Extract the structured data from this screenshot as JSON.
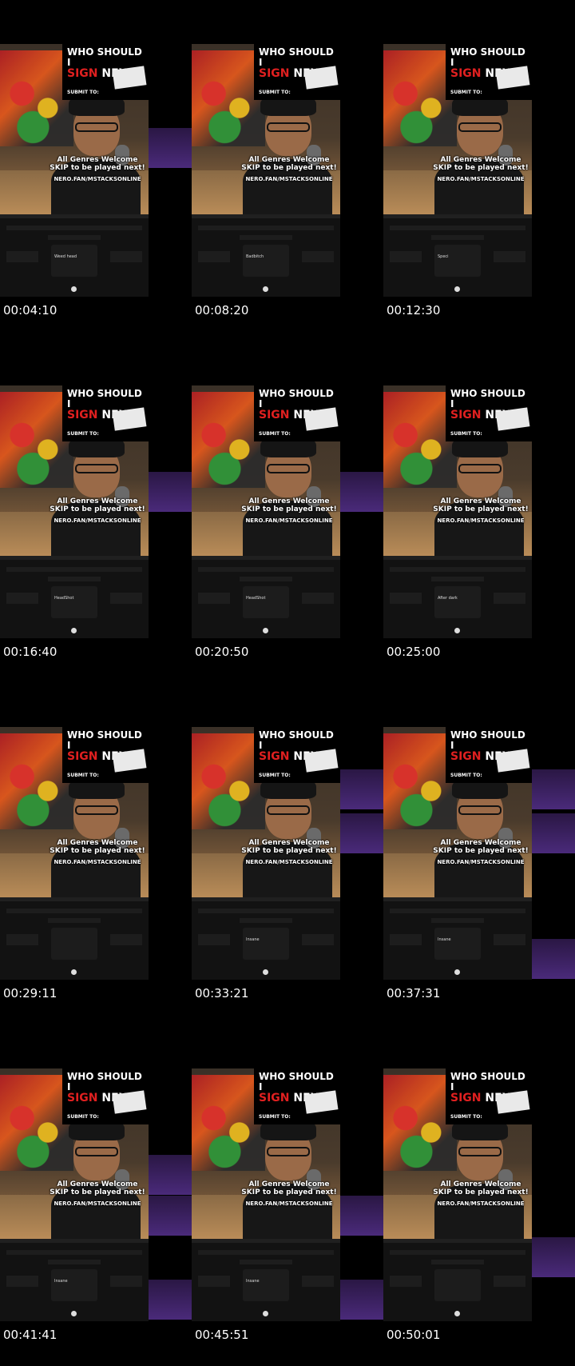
{
  "overlay": {
    "headline_line1": "WHO SHOULD I",
    "headline_sign": "SIGN",
    "headline_next": "NEXT?",
    "submit": "SUBMIT TO:",
    "caption_line1": "All Genres Welcome",
    "caption_line2": "SKIP to be played next!",
    "caption_url": "NERO.FAN/MSTACKSONLINE"
  },
  "frames": [
    {
      "time": "00:04:10",
      "track": "Weed head"
    },
    {
      "time": "00:08:20",
      "track": "Badbitch"
    },
    {
      "time": "00:12:30",
      "track": "Speci"
    },
    {
      "time": "00:16:40",
      "track": "HeadShot"
    },
    {
      "time": "00:20:50",
      "track": "HeadShot"
    },
    {
      "time": "00:25:00",
      "track": "After dark"
    },
    {
      "time": "00:29:11",
      "track": ""
    },
    {
      "time": "00:33:21",
      "track": "Insane"
    },
    {
      "time": "00:37:31",
      "track": "Insane"
    },
    {
      "time": "00:41:41",
      "track": "Insane"
    },
    {
      "time": "00:45:51",
      "track": "Insane"
    },
    {
      "time": "00:50:01",
      "track": ""
    }
  ]
}
